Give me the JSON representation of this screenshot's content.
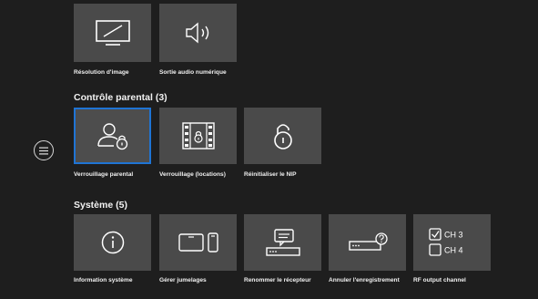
{
  "nav": {
    "menu_icon": "hamburger-icon"
  },
  "sections": {
    "display": {
      "tiles": [
        {
          "label": "Résolution d'image",
          "icon": "monitor-icon"
        },
        {
          "label": "Sortie audio numérique",
          "icon": "speaker-icon"
        }
      ]
    },
    "parental": {
      "title": "Contrôle parental (3)",
      "tiles": [
        {
          "label": "Verrouillage parental",
          "icon": "user-lock-icon",
          "selected": true
        },
        {
          "label": "Verrouillage (locations)",
          "icon": "film-lock-icon"
        },
        {
          "label": "Réinitialiser le NIP",
          "icon": "unlock-icon"
        }
      ]
    },
    "system": {
      "title": "Système (5)",
      "tiles": [
        {
          "label": "Information système",
          "icon": "info-icon"
        },
        {
          "label": "Gérer jumelages",
          "icon": "tablet-phone-icon"
        },
        {
          "label": "Renommer le récepteur",
          "icon": "receiver-message-icon"
        },
        {
          "label": "Annuler l'enregistrement",
          "icon": "receiver-question-icon"
        },
        {
          "label": "RF output channel",
          "icon": "checkbox-channel-icon",
          "options": [
            "CH 3",
            "CH 4"
          ],
          "checked": "CH 3"
        }
      ]
    }
  },
  "colors": {
    "background": "#1e1e1e",
    "tile": "#4a4a4a",
    "focus": "#1f74d4"
  }
}
